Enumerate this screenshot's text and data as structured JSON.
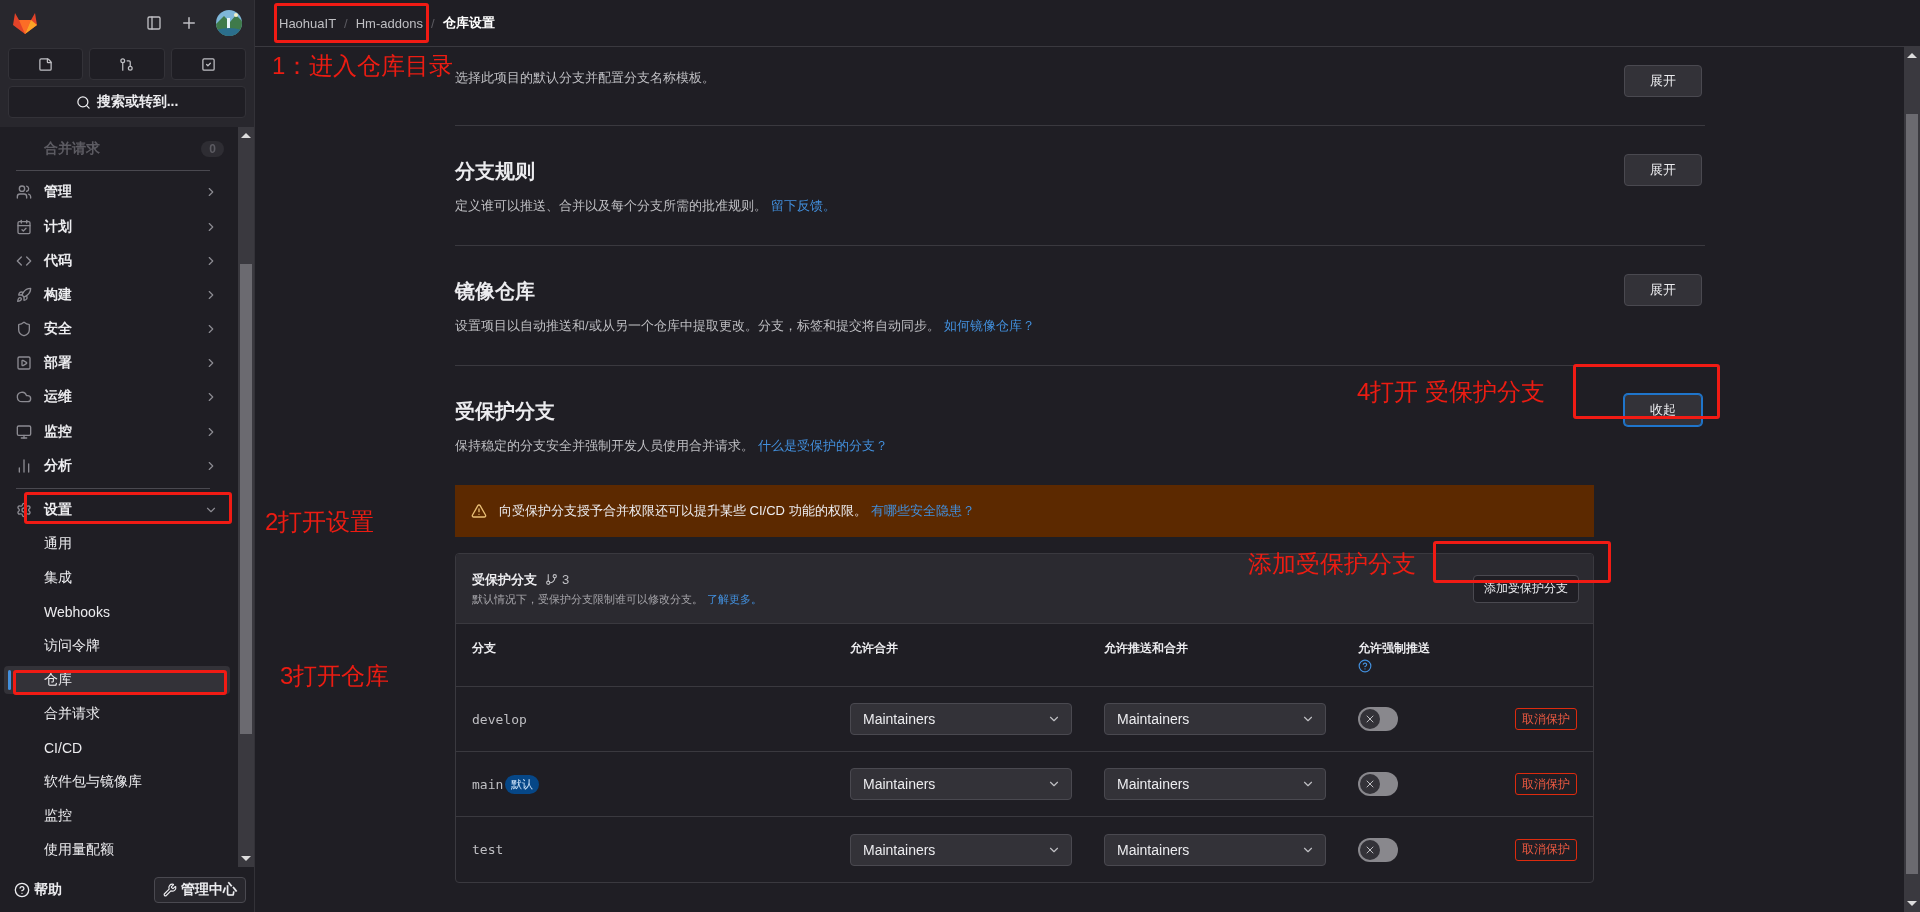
{
  "breadcrumb": [
    {
      "label": "HaohuaIT",
      "current": false
    },
    {
      "label": "Hm-addons",
      "current": false
    },
    {
      "label": "仓库设置",
      "current": true
    }
  ],
  "breadcrumb_separator": "/",
  "sidebar": {
    "search": {
      "placeholder": "搜索或转到..."
    },
    "faded_item": {
      "label": "合并请求",
      "count": "0"
    },
    "items": [
      {
        "label": "管理"
      },
      {
        "label": "计划"
      },
      {
        "label": "代码"
      },
      {
        "label": "构建"
      },
      {
        "label": "安全"
      },
      {
        "label": "部署"
      },
      {
        "label": "运维"
      },
      {
        "label": "监控"
      },
      {
        "label": "分析"
      }
    ],
    "settings": {
      "label": "设置",
      "expanded": true,
      "children": [
        {
          "label": "通用",
          "selected": false
        },
        {
          "label": "集成",
          "selected": false
        },
        {
          "label": "Webhooks",
          "selected": false
        },
        {
          "label": "访问令牌",
          "selected": false
        },
        {
          "label": "仓库",
          "selected": true
        },
        {
          "label": "合并请求",
          "selected": false
        },
        {
          "label": "CI/CD",
          "selected": false
        },
        {
          "label": "软件包与镜像库",
          "selected": false
        },
        {
          "label": "监控",
          "selected": false
        },
        {
          "label": "使用量配额",
          "selected": false
        }
      ]
    },
    "help": "帮助",
    "admin": "管理中心"
  },
  "sections": [
    {
      "description": "选择此项目的默认分支并配置分支名称模板。",
      "button": "展开",
      "expanded": false
    },
    {
      "title": "分支规则",
      "description": "定义谁可以推送、合并以及每个分支所需的批准规则。",
      "link": "留下反馈。",
      "button": "展开",
      "expanded": false
    },
    {
      "title": "镜像仓库",
      "description": "设置项目以自动推送和/或从另一个仓库中提取更改。分支，标签和提交将自动同步。",
      "link": "如何镜像仓库？",
      "button": "展开",
      "expanded": false
    },
    {
      "title": "受保护分支",
      "description": "保持稳定的分支安全并强制开发人员使用合并请求。",
      "link": "什么是受保护的分支？",
      "button": "收起",
      "expanded": true
    }
  ],
  "protected": {
    "alert": {
      "text": "向受保护分支授予合并权限还可以提升某些 CI/CD 功能的权限。",
      "link": "有哪些安全隐患？"
    },
    "card": {
      "title": "受保护分支",
      "count": "3",
      "description": "默认情况下，受保护分支限制谁可以修改分支。",
      "link": "了解更多。",
      "add_button": "添加受保护分支",
      "columns": [
        "分支",
        "允许合并",
        "允许推送和合并",
        "允许强制推送"
      ],
      "rows": [
        {
          "branch": "develop",
          "merge": "Maintainers",
          "push": "Maintainers",
          "force_push": false,
          "action": "取消保护"
        },
        {
          "branch": "main",
          "badge": "默认",
          "merge": "Maintainers",
          "push": "Maintainers",
          "force_push": false,
          "action": "取消保护"
        },
        {
          "branch": "test",
          "merge": "Maintainers",
          "push": "Maintainers",
          "force_push": false,
          "action": "取消保护"
        }
      ]
    }
  },
  "annotations": [
    {
      "text": "1：进入仓库目录"
    },
    {
      "text": "2打开设置"
    },
    {
      "text": "3打开仓库"
    },
    {
      "text": "4打开 受保护分支"
    },
    {
      "text": "添加受保护分支"
    }
  ]
}
